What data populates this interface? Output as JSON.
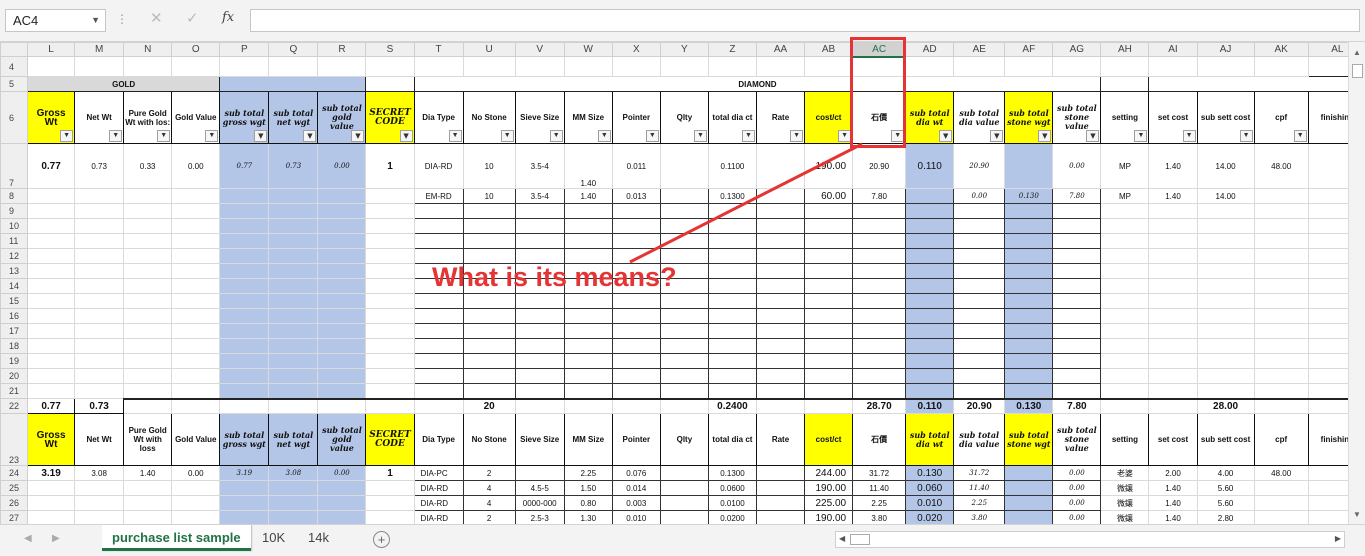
{
  "formula_bar": {
    "name_box": "AC4",
    "cancel_icon": "✕",
    "enter_icon": "✓",
    "fx": "fx",
    "formula": ""
  },
  "columns": [
    "L",
    "M",
    "N",
    "O",
    "P",
    "Q",
    "R",
    "S",
    "T",
    "U",
    "V",
    "W",
    "X",
    "Y",
    "Z",
    "AA",
    "AB",
    "AC",
    "AD",
    "AE",
    "AF",
    "AG",
    "AH",
    "AI",
    "AJ",
    "AK",
    "AL"
  ],
  "selected_column": "AC",
  "rows": {
    "r4": "4",
    "r5": "5",
    "r6": "6",
    "r7": "7",
    "r8": "8",
    "r9": "9",
    "r10": "10",
    "r11": "11",
    "r12": "12",
    "r13": "13",
    "r14": "14",
    "r15": "15",
    "r16": "16",
    "r17": "17",
    "r18": "18",
    "r19": "19",
    "r20": "20",
    "r21": "21",
    "r22": "22",
    "r23": "23",
    "r24": "24",
    "r25": "25",
    "r26": "26",
    "r27": "27"
  },
  "sections": {
    "gold": "GOLD",
    "diamond": "DIAMOND"
  },
  "headers": {
    "gross_wt": "Gross Wt",
    "net_wt": "Net Wt",
    "pure_gold": "Pure Gold Wt with loss",
    "pure_gold_trunc": "Pure Gold Wt with los:",
    "gold_value": "Gold Value",
    "sub_gross": "sub total gross wgt",
    "sub_net": "sub total net wgt",
    "sub_gold": "sub total gold value",
    "secret_code": "SECRET CODE",
    "dia_type": "Dia Type",
    "no_stone": "No Stone",
    "sieve": "Sieve Size",
    "mm": "MM Size",
    "pointer": "Pointer",
    "qlty": "Qlty",
    "total_dia": "total dia ct",
    "rate": "Rate",
    "cost_ct": "cost/ct",
    "shiyi": "石價",
    "sub_dia_wt": "sub total dia wt",
    "sub_dia_value": "sub total dia value",
    "sub_stone_wt": "sub total stone wgt",
    "sub_stone_value": "sub total stone value",
    "setting": "setting",
    "set_cost": "set cost",
    "sub_sett": "sub sett cost",
    "cpf": "cpf",
    "finishing": "finishing"
  },
  "row7": {
    "gross": "0.77",
    "net": "0.73",
    "pure": "0.33",
    "gold": "0.00",
    "sg": "0.77",
    "sn": "0.73",
    "sgv": "0.00",
    "code": "1",
    "type": "DIA-RD",
    "stones": "10",
    "sieve": "3.5-4",
    "mm": "1.40",
    "pointer": "0.011",
    "total": "0.1100",
    "cost": "190.00",
    "shiyi": "20.90",
    "sdw": "0.110",
    "sdv": "20.90",
    "ssv": "0.00",
    "setting": "MP",
    "setc": "1.40",
    "subset": "14.00",
    "cpf": "48.00"
  },
  "row8": {
    "type": "EM-RD",
    "stones": "10",
    "sieve": "3.5-4",
    "mm": "1.40",
    "pointer": "0.013",
    "total": "0.1300",
    "cost": "60.00",
    "shiyi": "7.80",
    "sdv": "0.00",
    "ssw": "0.130",
    "ssv": "7.80",
    "setting": "MP",
    "setc": "1.40",
    "subset": "14.00"
  },
  "row22": {
    "gross": "0.77",
    "net": "0.73",
    "stones": "20",
    "total": "0.2400",
    "shiyi": "28.70",
    "sdw": "0.110",
    "sdv": "20.90",
    "ssw": "0.130",
    "ssv": "7.80",
    "subset": "28.00"
  },
  "row24": {
    "gross": "3.19",
    "net": "3.08",
    "pure": "1.40",
    "gold": "0.00",
    "sg": "3.19",
    "sn": "3.08",
    "sgv": "0.00",
    "code": "1",
    "type": "DIA-PC",
    "stones": "2",
    "mm": "2.25",
    "pointer": "0.076",
    "total": "0.1300",
    "cost": "244.00",
    "shiyi": "31.72",
    "sdw": "0.130",
    "sdv": "31.72",
    "ssv": "0.00",
    "setting": "老婆",
    "setc": "2.00",
    "subset": "4.00",
    "cpf": "48.00"
  },
  "row25": {
    "type": "DIA-RD",
    "stones": "4",
    "sieve": "4.5-5",
    "mm": "1.50",
    "pointer": "0.014",
    "total": "0.0600",
    "cost": "190.00",
    "shiyi": "11.40",
    "sdw": "0.060",
    "sdv": "11.40",
    "ssv": "0.00",
    "setting": "微鑲",
    "setc": "1.40",
    "subset": "5.60"
  },
  "row26": {
    "type": "DIA-RD",
    "stones": "4",
    "sieve": "0000-000",
    "mm": "0.80",
    "pointer": "0.003",
    "total": "0.0100",
    "cost": "225.00",
    "shiyi": "2.25",
    "sdw": "0.010",
    "sdv": "2.25",
    "ssv": "0.00",
    "setting": "微鑲",
    "setc": "1.40",
    "subset": "5.60"
  },
  "row27": {
    "type": "DIA-RD",
    "stones": "2",
    "sieve": "2.5-3",
    "mm": "1.30",
    "pointer": "0.010",
    "total": "0.0200",
    "cost": "190.00",
    "shiyi": "3.80",
    "sdw": "0.020",
    "sdv": "3.80",
    "ssv": "0.00",
    "setting": "微鑲",
    "setc": "1.40",
    "subset": "2.80"
  },
  "annotation": {
    "text": "What is its means?",
    "color": "#e53434"
  },
  "sheet_tabs": [
    "purchase list sample",
    "10K",
    "14k"
  ],
  "active_tab": "purchase list sample",
  "colors": {
    "yellow": "#ffff00",
    "blue": "#b4c6e7",
    "excel_green": "#217346"
  }
}
